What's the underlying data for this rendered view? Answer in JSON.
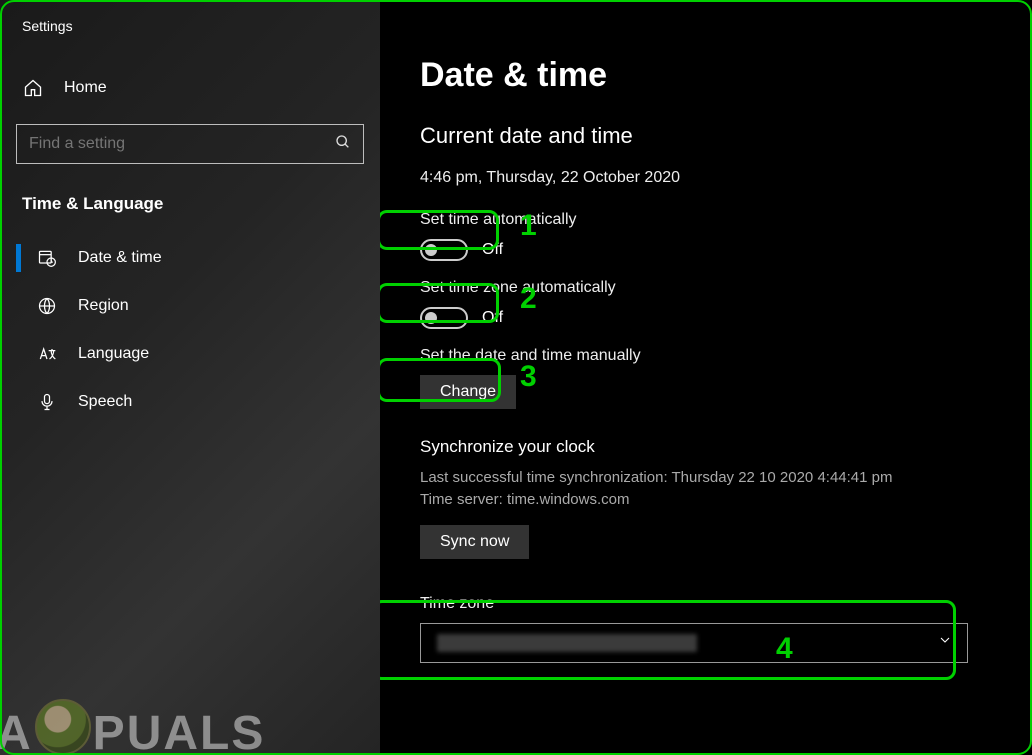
{
  "sidebar": {
    "app_title": "Settings",
    "home_label": "Home",
    "search_placeholder": "Find a setting",
    "category": "Time & Language",
    "items": [
      {
        "icon": "calendar-clock-icon",
        "label": "Date & time",
        "selected": true
      },
      {
        "icon": "globe-icon",
        "label": "Region",
        "selected": false
      },
      {
        "icon": "language-icon",
        "label": "Language",
        "selected": false
      },
      {
        "icon": "mic-icon",
        "label": "Speech",
        "selected": false
      }
    ],
    "watermark_left": "A",
    "watermark_right": "PUALS"
  },
  "main": {
    "title": "Date & time",
    "section_current": "Current date and time",
    "current_datetime": "4:46 pm, Thursday, 22 October 2020",
    "set_time_auto_label": "Set time automatically",
    "set_time_auto_state": "Off",
    "set_tz_auto_label": "Set time zone automatically",
    "set_tz_auto_state": "Off",
    "set_manual_label": "Set the date and time manually",
    "change_btn": "Change",
    "sync_heading": "Synchronize your clock",
    "sync_last": "Last successful time synchronization: Thursday 22 10 2020 4:44:41 pm",
    "sync_server": "Time server: time.windows.com",
    "sync_btn": "Sync now",
    "tz_heading": "Time zone"
  },
  "annotations": {
    "n1": "1",
    "n2": "2",
    "n3": "3",
    "n4": "4"
  }
}
